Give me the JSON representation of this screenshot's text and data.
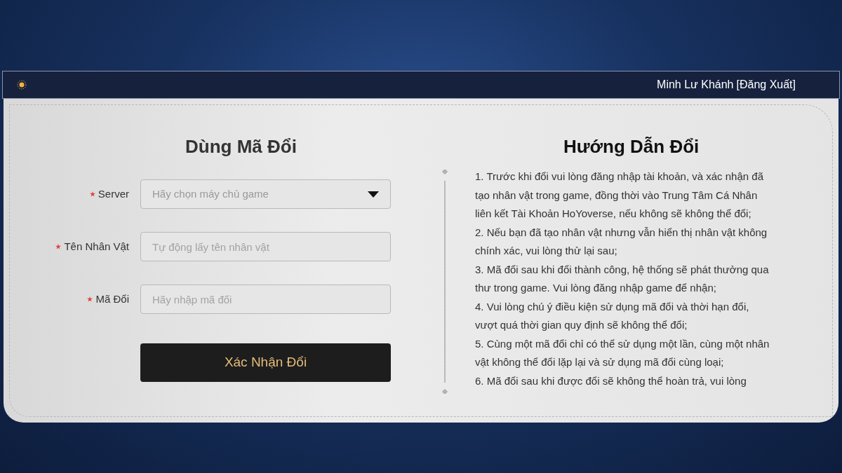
{
  "header": {
    "user_name": "Minh Lư Khánh",
    "logout": "[Đăng Xuất]"
  },
  "form": {
    "title": "Dùng Mã Đổi",
    "fields": [
      {
        "kind": "select",
        "label": "Server",
        "required": true,
        "placeholder": "Hãy chọn máy chủ game"
      },
      {
        "kind": "input",
        "label": "Tên Nhân Vật",
        "required": true,
        "placeholder": "Tự động lấy tên nhân vật"
      },
      {
        "kind": "input",
        "label": "Mã Đổi",
        "required": true,
        "placeholder": "Hãy nhập mã đổi"
      }
    ],
    "submit": "Xác Nhận Đổi"
  },
  "guide": {
    "title": "Hướng Dẫn Đổi",
    "items": [
      "1. Trước khi đổi vui lòng đăng nhập tài khoản, và xác nhận đã tạo nhân vật trong game, đồng thời vào Trung Tâm Cá Nhân liên kết Tài Khoản HoYoverse, nếu không sẽ không thể đổi;",
      "2. Nếu bạn đã tạo nhân vật nhưng vẫn hiển thị nhân vật không chính xác, vui lòng thử lại sau;",
      "3. Mã đổi sau khi đổi thành công, hệ thống sẽ phát thưởng qua thư trong game. Vui lòng đăng nhập game để nhận;",
      "4. Vui lòng chú ý điều kiện sử dụng mã đổi và thời hạn đổi, vượt quá thời gian quy định sẽ không thể đổi;",
      "5. Cùng một mã đổi chỉ có thể sử dụng một lần, cùng một nhân vật không thể đổi lặp lại và sử dụng mã đổi cùng loại;",
      "6. Mã đổi sau khi được đổi sẽ không thể hoàn trả, vui lòng"
    ]
  }
}
